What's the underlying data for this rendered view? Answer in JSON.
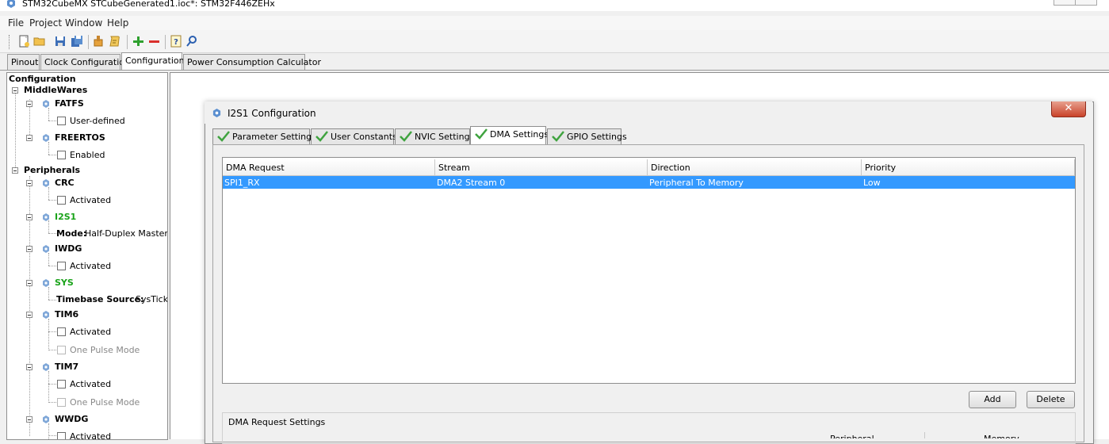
{
  "window": {
    "title": "STM32CubeMX STCubeGenerated1.ioc*: STM32F446ZEHx"
  },
  "menu": [
    "File",
    "Project",
    "Window",
    "Help"
  ],
  "toolbar": {
    "icons": [
      "new-project-icon",
      "open-icon",
      "save-icon",
      "save-as-icon",
      "generate-icon",
      "report-icon",
      "add-icon",
      "remove-icon",
      "help-icon",
      "about-icon"
    ]
  },
  "main_tabs": [
    "Pinout",
    "Clock Configuration",
    "Configuration",
    "Power Consumption Calculator"
  ],
  "tree": {
    "root": "Configuration",
    "middlewares": "MiddleWares",
    "fatfs": "FATFS",
    "fatfs_opt": "User-defined",
    "freertos": "FREERTOS",
    "freertos_opt": "Enabled",
    "peripherals": "Peripherals",
    "crc": "CRC",
    "crc_opt": "Activated",
    "i2s1": "I2S1",
    "i2s1_mode_label": "Mode:",
    "i2s1_mode_value": "Half-Duplex Master",
    "iwdg": "IWDG",
    "iwdg_opt": "Activated",
    "sys": "SYS",
    "sys_tb_label": "Timebase Source:",
    "sys_tb_value": "SysTick",
    "tim6": "TIM6",
    "tim6_opt1": "Activated",
    "tim6_opt2": "One Pulse Mode",
    "tim7": "TIM7",
    "tim7_opt1": "Activated",
    "tim7_opt2": "One Pulse Mode",
    "wwdg": "WWDG",
    "wwdg_opt": "Activated"
  },
  "dialog": {
    "title": "I2S1 Configuration",
    "close": "✕",
    "tabs": [
      "Parameter Settings",
      "User Constants",
      "NVIC Settings",
      "DMA Settings",
      "GPIO Settings"
    ],
    "table": {
      "columns": [
        "DMA Request",
        "Stream",
        "Direction",
        "Priority"
      ],
      "rows": [
        [
          "SPI1_RX",
          "DMA2 Stream 0",
          "Peripheral To Memory",
          "Low"
        ]
      ]
    },
    "add_label": "Add",
    "delete_label": "Delete",
    "request_settings_label": "DMA Request Settings",
    "partial_col_1": "Peripheral",
    "partial_col_2": "Memory"
  },
  "colors": {
    "selection": "#3399ff",
    "active_text": "#1aa31a",
    "close_button": "#c9432a"
  }
}
